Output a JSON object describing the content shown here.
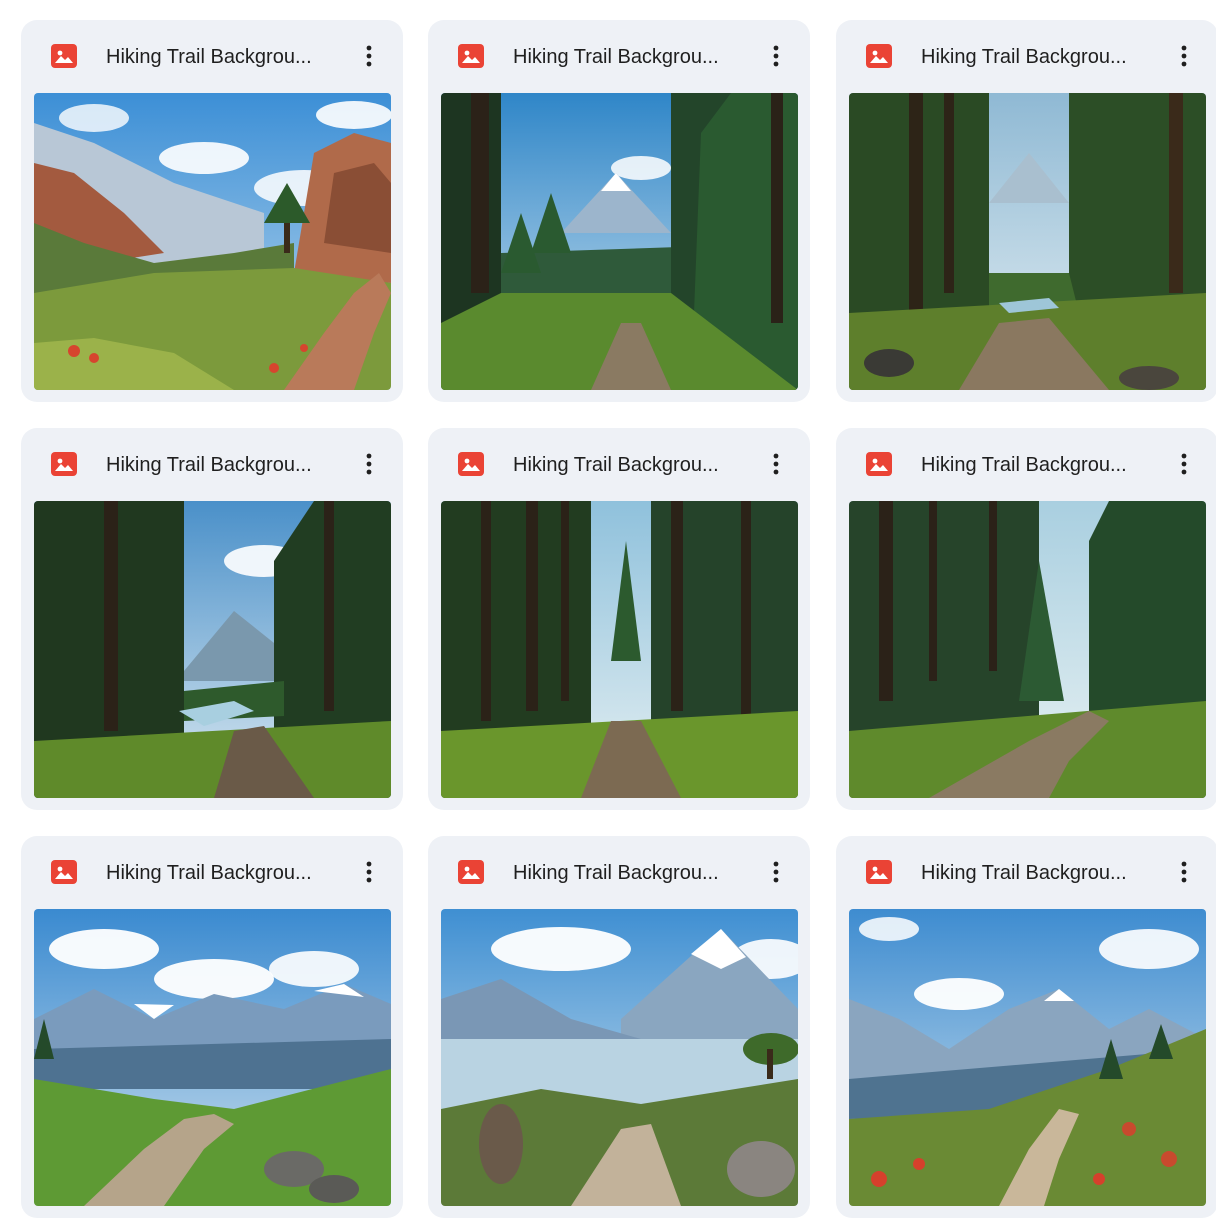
{
  "files": [
    {
      "title": "Hiking Trail Backgrou...",
      "icon": "image-file-icon",
      "thumbnail": "mountain-valley-rocky-trail-thumbnail"
    },
    {
      "title": "Hiking Trail Backgrou...",
      "icon": "image-file-icon",
      "thumbnail": "forest-trail-mountain-view-thumbnail"
    },
    {
      "title": "Hiking Trail Backgrou...",
      "icon": "image-file-icon",
      "thumbnail": "forest-trail-creek-thumbnail"
    },
    {
      "title": "Hiking Trail Backgrou...",
      "icon": "image-file-icon",
      "thumbnail": "pine-forest-river-trail-thumbnail"
    },
    {
      "title": "Hiking Trail Backgrou...",
      "icon": "image-file-icon",
      "thumbnail": "tall-pine-forest-path-thumbnail"
    },
    {
      "title": "Hiking Trail Backgrou...",
      "icon": "image-file-icon",
      "thumbnail": "forest-dirt-road-thumbnail"
    },
    {
      "title": "Hiking Trail Backgrou...",
      "icon": "image-file-icon",
      "thumbnail": "alpine-meadow-trail-thumbnail"
    },
    {
      "title": "Hiking Trail Backgrou...",
      "icon": "image-file-icon",
      "thumbnail": "mountain-peak-lake-trail-thumbnail"
    },
    {
      "title": "Hiking Trail Backgrou...",
      "icon": "image-file-icon",
      "thumbnail": "alpine-wildflower-trail-thumbnail"
    }
  ],
  "colors": {
    "card_background": "#eef1f6",
    "image_icon": "#ea4335",
    "title_text": "#1f1f1f"
  }
}
